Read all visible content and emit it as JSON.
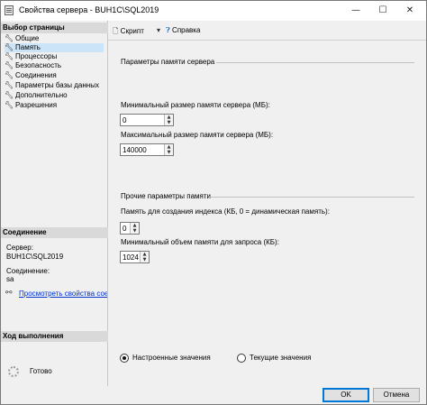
{
  "window": {
    "title": "Свойства сервера - BUH1C\\SQL2019",
    "min_glyph": "—",
    "max_glyph": "☐",
    "close_glyph": "✕"
  },
  "sidebar": {
    "pages_header": "Выбор страницы",
    "items": [
      {
        "label": "Общие",
        "selected": false
      },
      {
        "label": "Память",
        "selected": true
      },
      {
        "label": "Процессоры",
        "selected": false
      },
      {
        "label": "Безопасность",
        "selected": false
      },
      {
        "label": "Соединения",
        "selected": false
      },
      {
        "label": "Параметры базы данных",
        "selected": false
      },
      {
        "label": "Дополнительно",
        "selected": false
      },
      {
        "label": "Разрешения",
        "selected": false
      }
    ],
    "connection_header": "Соединение",
    "server_label": "Сервер:",
    "server_value": "BUH1C\\SQL2019",
    "connection_label": "Соединение:",
    "connection_value": "sa",
    "view_connection_link": "Просмотреть свойства соединения",
    "progress_header": "Ход выполнения",
    "progress_status": "Готово"
  },
  "toolbar": {
    "script_label": "Скрипт",
    "help_label": "Справка"
  },
  "server_memory": {
    "title": "Параметры памяти сервера",
    "min_label": "Минимальный размер памяти сервера (МБ):",
    "min_value": "0",
    "max_label": "Максимальный размер памяти сервера (МБ):",
    "max_value": "140000"
  },
  "other_memory": {
    "title": "Прочие параметры памяти",
    "index_label": "Память для создания индекса (КБ, 0 = динамическая память):",
    "index_value": "0",
    "query_label": "Минимальный объем памяти для запроса (КБ):",
    "query_value": "1024"
  },
  "values_mode": {
    "configured_label": "Настроенные значения",
    "running_label": "Текущие значения",
    "selected": "configured"
  },
  "buttons": {
    "ok": "OK",
    "cancel": "Отмена"
  }
}
